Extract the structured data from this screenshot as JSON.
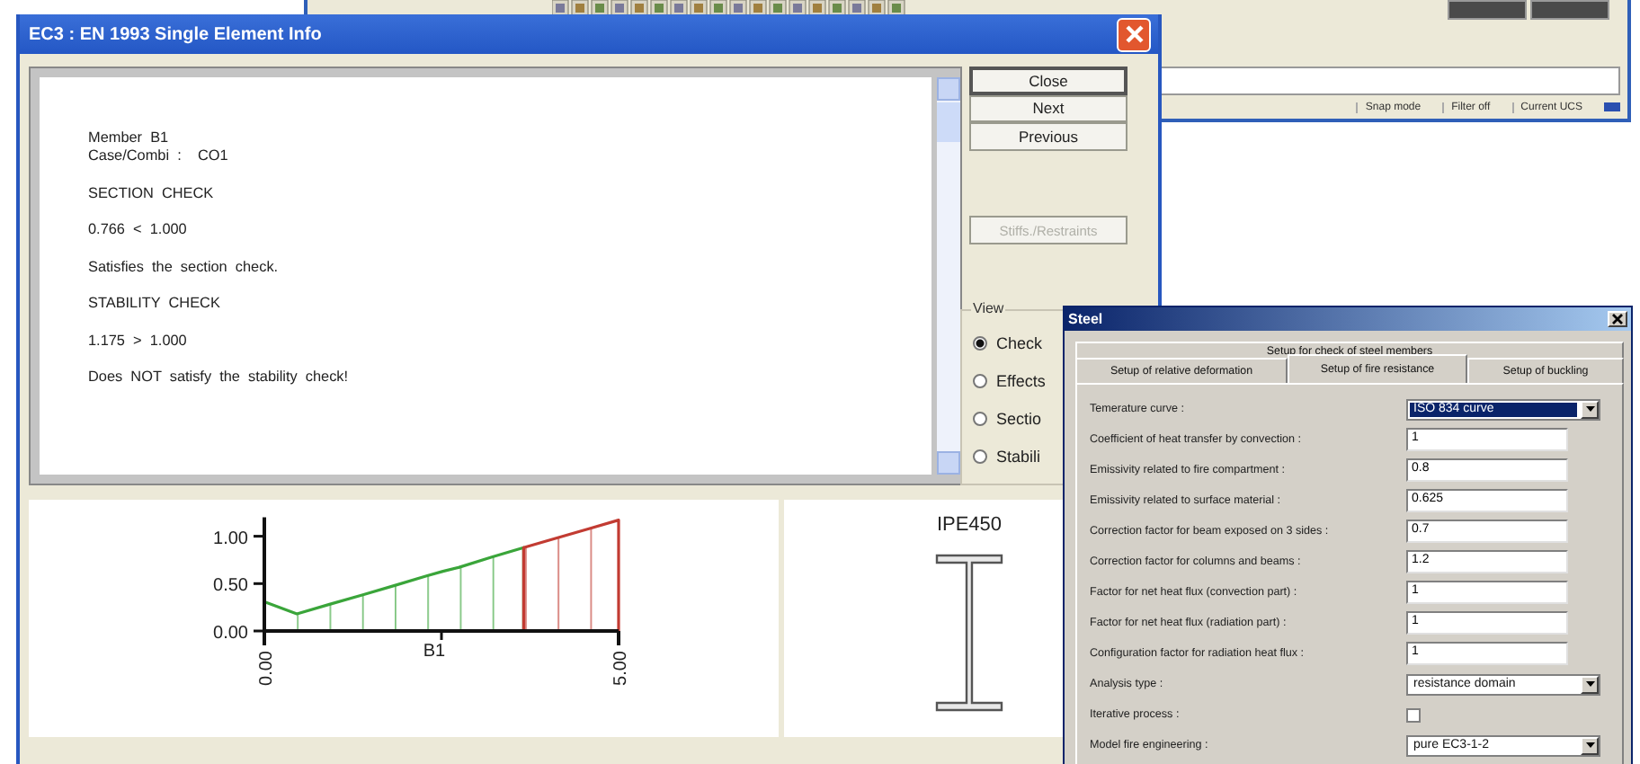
{
  "background_window": {
    "status_bar": [
      "Snap mode",
      "Filter off",
      "Current UCS"
    ]
  },
  "info_window": {
    "title": "EC3 : EN 1993 Single Element Info",
    "report": [
      [
        "Member  B1",
        "Case/Combi  :    CO1"
      ],
      [
        "SECTION  CHECK"
      ],
      [
        "0.766  <  1.000"
      ],
      [
        "Satisfies  the  section  check."
      ],
      [
        "STABILITY  CHECK"
      ],
      [
        "1.175  >  1.000"
      ],
      [
        "Does  NOT  satisfy  the  stability  check!"
      ]
    ],
    "buttons": [
      {
        "label": "Close",
        "default": true,
        "disabled": false
      },
      {
        "label": "Next",
        "default": false,
        "disabled": false
      },
      {
        "label": "Previous",
        "default": false,
        "disabled": false
      }
    ],
    "extra_button": {
      "label": "Stiffs./Restraints",
      "disabled": true
    },
    "view": {
      "label": "View",
      "options": [
        {
          "label": "Check",
          "selected": true
        },
        {
          "label": "Effects",
          "selected": false
        },
        {
          "label": "Sectio",
          "selected": false
        },
        {
          "label": "Stabili",
          "selected": false
        }
      ]
    },
    "check_chart": {
      "chart_data": {
        "type": "area",
        "xlabel": "B1",
        "x": [
          0,
          0.46,
          0.92,
          1.38,
          1.84,
          2.29,
          2.52,
          2.74,
          3.21,
          3.66,
          4.12,
          4.58,
          5.0
        ],
        "series": [
          {
            "color": "#3aa53a",
            "values": [
              0.31,
              0.18,
              0.28,
              0.38,
              0.48,
              0.58,
              0.63,
              0.67,
              0.78,
              0.88,
              null,
              null,
              null
            ]
          },
          {
            "color": "#c23b32",
            "values": [
              null,
              null,
              null,
              null,
              null,
              null,
              null,
              null,
              null,
              0.88,
              0.98,
              1.08,
              1.17
            ]
          }
        ],
        "xlim": [
          0,
          5
        ],
        "ylim": [
          0,
          1.2
        ],
        "xticks": [
          {
            "value": 0,
            "label": "0.00"
          },
          {
            "value": 5,
            "label": "5.00"
          }
        ],
        "yticks": [
          {
            "value": 0,
            "label": "0.00"
          },
          {
            "value": 0.5,
            "label": "0.50"
          },
          {
            "value": 1,
            "label": "1.00"
          }
        ]
      }
    },
    "section": {
      "name": "IPE450"
    }
  },
  "steel_dialog": {
    "title": "Steel",
    "back_tabs": [
      {
        "label": "Setup for check of steel members",
        "selected": false
      }
    ],
    "tabs": [
      {
        "label": "Setup of relative deformation",
        "selected": false
      },
      {
        "label": "Setup of fire resistance",
        "selected": true
      },
      {
        "label": "Setup of buckling",
        "selected": false
      }
    ],
    "fields": [
      {
        "label": "Temerature curve :",
        "kind": "select",
        "value": "ISO 834 curve",
        "focused": true
      },
      {
        "label": "Coefficient of heat transfer by convection :",
        "kind": "text",
        "value": "1",
        "focused": false
      },
      {
        "label": "Emissivity related to fire compartment :",
        "kind": "text",
        "value": "0.8",
        "focused": false
      },
      {
        "label": "Emissivity related to surface material :",
        "kind": "text",
        "value": "0.625",
        "focused": false
      },
      {
        "label": "Correction factor for beam exposed on 3 sides :",
        "kind": "text",
        "value": "0.7",
        "focused": false
      },
      {
        "label": "Correction factor for columns and beams :",
        "kind": "text",
        "value": "1.2",
        "focused": false
      },
      {
        "label": "Factor for net heat flux (convection part) :",
        "kind": "text",
        "value": "1",
        "focused": false
      },
      {
        "label": "Factor for net heat flux (radiation part) :",
        "kind": "text",
        "value": "1",
        "focused": false
      },
      {
        "label": "Configuration factor  for radiation heat flux :",
        "kind": "text",
        "value": "1",
        "focused": false
      },
      {
        "label": "Analysis type :",
        "kind": "select",
        "value": "resistance domain",
        "focused": false
      },
      {
        "label": "Iterative process :",
        "kind": "checkbox",
        "checked": false,
        "focused": false
      },
      {
        "label": "Model fire engineering :",
        "kind": "select",
        "value": "pure EC3-1-2",
        "focused": false
      }
    ]
  }
}
